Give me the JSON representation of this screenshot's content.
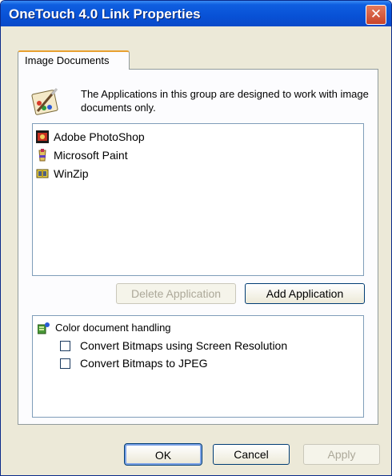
{
  "window": {
    "title": "OneTouch 4.0 Link Properties",
    "close_symbol": "✕"
  },
  "tabs": [
    {
      "label": "Image Documents",
      "selected": true
    }
  ],
  "group": {
    "icon": "paint-brush-icon",
    "description": "The Applications in this group are designed to work with image documents only."
  },
  "applications": [
    {
      "label": "Adobe PhotoShop",
      "icon": "photoshop-icon"
    },
    {
      "label": "Microsoft Paint",
      "icon": "paint-icon"
    },
    {
      "label": "WinZip",
      "icon": "winzip-icon"
    }
  ],
  "buttons": {
    "delete_application": "Delete Application",
    "add_application": "Add Application",
    "ok": "OK",
    "cancel": "Cancel",
    "apply": "Apply"
  },
  "options": {
    "header": "Color document handling",
    "header_icon": "color-document-icon",
    "items": [
      {
        "label": "Convert Bitmaps using Screen Resolution",
        "checked": false
      },
      {
        "label": "Convert Bitmaps to JPEG",
        "checked": false
      }
    ]
  },
  "colors": {
    "title_bar": "#0851d6",
    "tab_accent": "#e8a030",
    "close_button": "#c8442a"
  }
}
